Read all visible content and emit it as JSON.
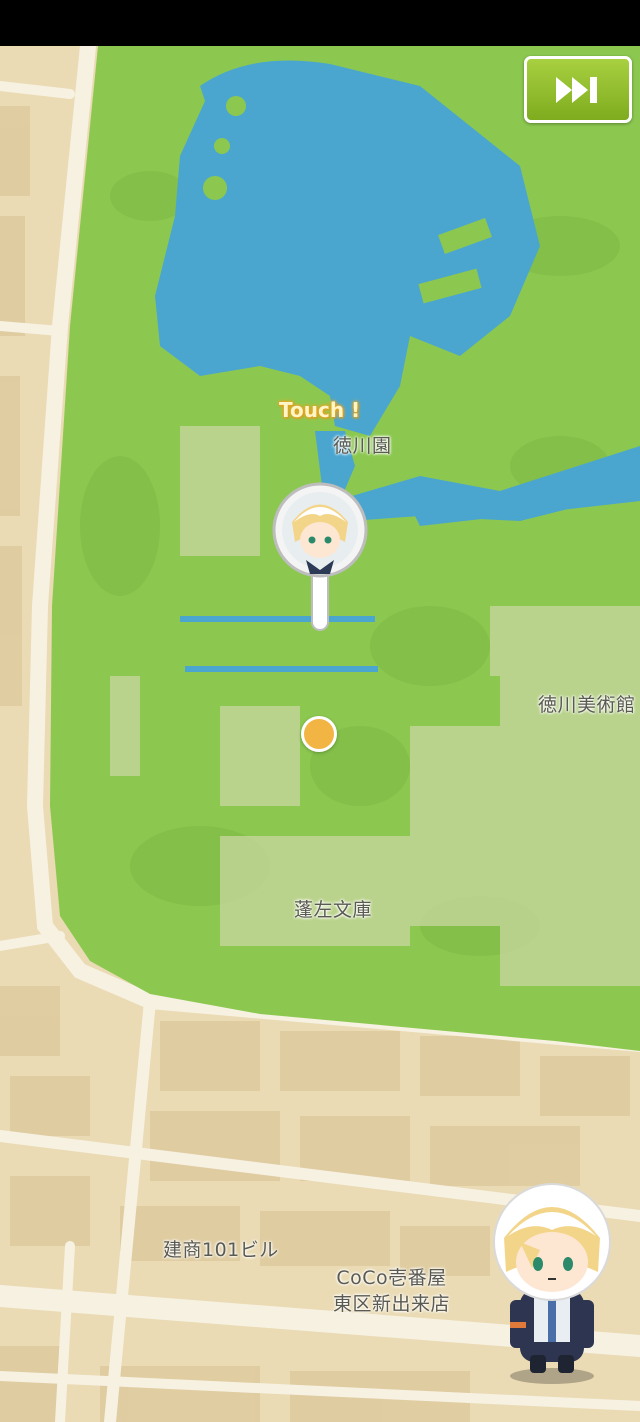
{
  "map": {
    "labels": {
      "park": "徳川園",
      "museum": "徳川美術館",
      "library": "蓬左文庫",
      "building": "建商101ビル",
      "store_line1": "CoCo壱番屋",
      "store_line2": "東区新出来店"
    },
    "touch_prompt": "Touch !"
  },
  "controls": {
    "skip_icon": "fast-forward-icon"
  },
  "colors": {
    "park_green": "#8cc850",
    "water": "#4aa6cf",
    "land": "#eadbb4",
    "road": "#f7f1e2",
    "accent": "#f2b443",
    "skip_button": "#8cbf2a"
  }
}
